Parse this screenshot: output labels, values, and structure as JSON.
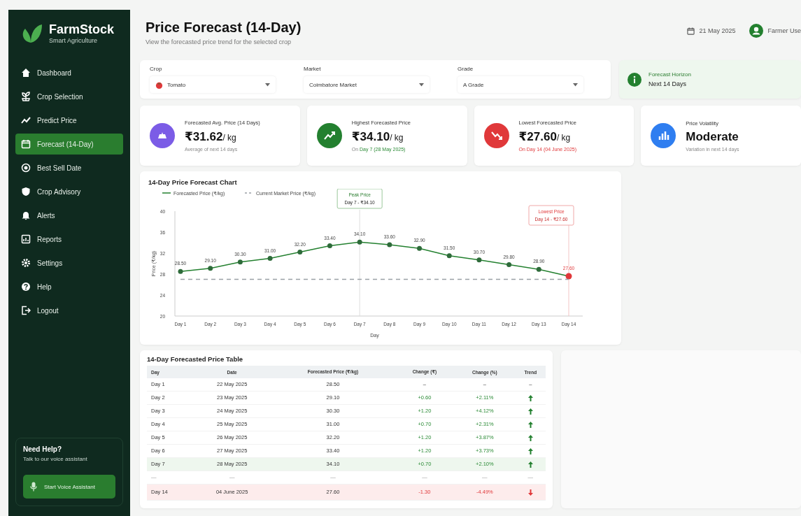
{
  "brand": {
    "name": "FarmStock",
    "tagline": "Smart Agriculture"
  },
  "nav": [
    {
      "label": "Dashboard",
      "selected": false
    },
    {
      "label": "Crop Selection",
      "selected": false
    },
    {
      "label": "Predict Price",
      "selected": false
    },
    {
      "label": "Forecast (14-Day)",
      "selected": true
    },
    {
      "label": "Best Sell Date",
      "selected": false
    },
    {
      "label": "Crop Advisory",
      "selected": false
    },
    {
      "label": "Alerts",
      "selected": false
    },
    {
      "label": "Reports",
      "selected": false
    },
    {
      "label": "Settings",
      "selected": false
    },
    {
      "label": "Help",
      "selected": false
    },
    {
      "label": "Logout",
      "selected": false
    }
  ],
  "help_card": {
    "title": "Need Help?",
    "text": "Talk to our voice assistant",
    "button": "Start Voice Assistant"
  },
  "header": {
    "title": "Price Forecast (14-Day)",
    "subtitle": "View the forecasted price trend for the selected crop",
    "date": "21 May 2025",
    "user": "Farmer Use"
  },
  "filters": [
    {
      "label": "Crop",
      "value": "Tomato",
      "kind": "crop"
    },
    {
      "label": "Market",
      "value": "Coimbatore Market",
      "kind": "plain"
    },
    {
      "label": "Grade",
      "value": "A Grade",
      "kind": "plain"
    }
  ],
  "horizon": {
    "label": "Forecast Horizon",
    "value": "Next 14 Days"
  },
  "stats": [
    {
      "label": "Forecasted Avg. Price (14 Days)",
      "value": "₹31.62",
      "unit": "/ kg",
      "color": "#7b5ce6",
      "note": [
        {
          "text": "Average of next 14 days",
          "kind": "neutral"
        }
      ]
    },
    {
      "label": "Highest Forecasted Price",
      "value": "₹34.10",
      "unit": "/ kg",
      "color": "#23802f",
      "note": [
        {
          "text": "On ",
          "kind": "neutral"
        },
        {
          "text": "Day 7 (28 May 2025)",
          "kind": "positive"
        }
      ]
    },
    {
      "label": "Lowest Forecasted Price",
      "value": "₹27.60",
      "unit": "/ kg",
      "color": "#e0383a",
      "note": [
        {
          "text": "On Day 14 (04 June 2025)",
          "kind": "negative"
        }
      ]
    },
    {
      "label": "Price Volatility",
      "value": "Moderate",
      "color": "#2f7ef0",
      "note": [
        {
          "text": "Variation in next 14 days",
          "kind": "neutral"
        }
      ]
    }
  ],
  "chart": {
    "title": "14-Day Price Forecast Chart",
    "chart_data": {
      "type": "line",
      "xlabel": "Day",
      "ylabel": "Price (₹/kg)",
      "categories": [
        "Day 1",
        "Day 2",
        "Day 3",
        "Day 4",
        "Day 5",
        "Day 6",
        "Day 7",
        "Day 8",
        "Day 9",
        "Day 10",
        "Day 11",
        "Day 12",
        "Day 13",
        "Day 14"
      ],
      "legend": "top-left",
      "series": [
        {
          "name": "Forecasted Price (₹/kg)",
          "color": "#23802f",
          "line_style": "solid",
          "marker": "circle",
          "values": [
            28.5,
            29.1,
            30.3,
            31.0,
            32.2,
            33.4,
            34.1,
            33.6,
            32.9,
            31.5,
            30.7,
            29.8,
            28.9,
            27.6
          ]
        },
        {
          "name": "Current Market Price (₹/kg)",
          "color": "#9aa0a6",
          "line_style": "dashed",
          "values": [
            27.0,
            27.0,
            27.0,
            27.0,
            27.0,
            27.0,
            27.0,
            27.0,
            27.0,
            27.0,
            27.0,
            27.0,
            27.0,
            27.0
          ]
        }
      ],
      "ylim": [
        20,
        40
      ],
      "yticks": [
        20,
        24,
        28,
        32,
        36,
        40
      ],
      "value_labels": [
        "28.50",
        "29.10",
        "30.30",
        "31.00",
        "32.20",
        "33.40",
        "34.10",
        "33.60",
        "32.90",
        "31.50",
        "30.70",
        "29.80",
        "28.90",
        "27.60"
      ],
      "ref_lines": [
        {
          "axis": "x",
          "value": "Day 7"
        },
        {
          "axis": "x",
          "value": "Day 14"
        }
      ],
      "annotations": [
        "Peak Price",
        "Day 7 - ₹34.10",
        "Lowest Price",
        "Day 14 - ₹27.60"
      ]
    }
  },
  "table": {
    "title": "14-Day Forecasted Price Table",
    "columns": [
      "Day",
      "Date",
      "Forecasted Price (₹/kg)",
      "Change (₹)",
      "Change (%)",
      "Trend"
    ],
    "rows": [
      {
        "kind": "flat",
        "cells": [
          "Day 1",
          "22 May 2025",
          "28.50",
          "–",
          "–",
          "–"
        ]
      },
      {
        "kind": "up",
        "cells": [
          "Day 2",
          "23 May 2025",
          "29.10",
          "+0.60",
          "+2.11%"
        ]
      },
      {
        "kind": "up",
        "cells": [
          "Day 3",
          "24 May 2025",
          "30.30",
          "+1.20",
          "+4.12%"
        ]
      },
      {
        "kind": "up",
        "cells": [
          "Day 4",
          "25 May 2025",
          "31.00",
          "+0.70",
          "+2.31%"
        ]
      },
      {
        "kind": "up",
        "cells": [
          "Day 5",
          "26 May 2025",
          "32.20",
          "+1.20",
          "+3.87%"
        ]
      },
      {
        "kind": "up",
        "cells": [
          "Day 6",
          "27 May 2025",
          "33.40",
          "+1.20",
          "+3.73%"
        ]
      },
      {
        "kind": "up",
        "color": "#eef7ee",
        "cells": [
          "Day 7",
          "28 May 2025",
          "34.10",
          "+0.70",
          "+2.10%"
        ]
      },
      {
        "kind": "gap",
        "cells": [
          "—",
          "—",
          "—",
          "—",
          "—",
          "—"
        ]
      },
      {
        "kind": "down",
        "color": "#fdecec",
        "cells": [
          "Day 14",
          "04 June 2025",
          "27.60",
          "-1.30",
          "-4.49%"
        ]
      }
    ]
  }
}
